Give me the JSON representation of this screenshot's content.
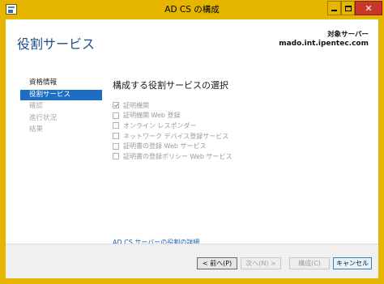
{
  "window": {
    "title": "AD CS の構成",
    "controls": {
      "minimize_icon": "minimize-icon",
      "maximize_icon": "maximize-icon",
      "close_icon": "close-icon",
      "close_glyph": "✕"
    },
    "accent_color": "#e5b500"
  },
  "header": {
    "page_title": "役割サービス",
    "target_label": "対象サーバー",
    "target_host": "mado.int.ipentec.com"
  },
  "nav": {
    "items": [
      {
        "label": "資格情報",
        "state": "normal"
      },
      {
        "label": "役割サービス",
        "state": "active"
      },
      {
        "label": "確認",
        "state": "disabled"
      },
      {
        "label": "進行状況",
        "state": "disabled"
      },
      {
        "label": "結果",
        "state": "disabled"
      }
    ]
  },
  "main": {
    "section_title": "構成する役割サービスの選択",
    "roles": [
      {
        "label": "証明機関",
        "checked": true
      },
      {
        "label": "証明機関 Web 登録",
        "checked": false
      },
      {
        "label": "オンライン レスポンダー",
        "checked": false
      },
      {
        "label": "ネットワーク デバイス登録サービス",
        "checked": false
      },
      {
        "label": "証明書の登録 Web サービス",
        "checked": false
      },
      {
        "label": "証明書の登録ポリシー Web サービス",
        "checked": false
      }
    ],
    "more_link": "AD CS サーバーの役割の詳細"
  },
  "footer": {
    "prev_label": "< 前へ(P)",
    "next_label": "次へ(N) >",
    "install_label": "構成(C)",
    "cancel_label": "キャンセル"
  }
}
